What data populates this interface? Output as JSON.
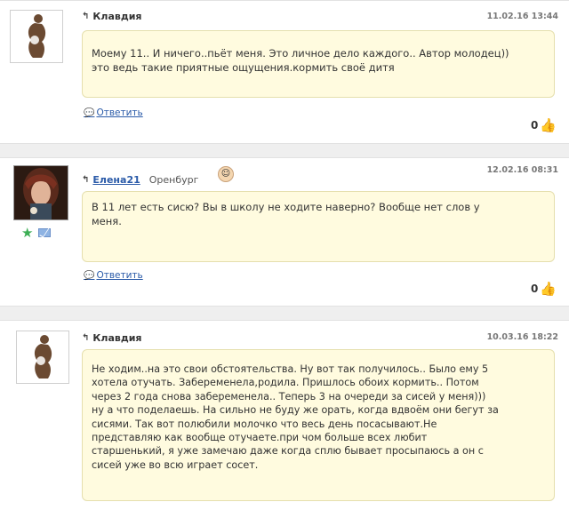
{
  "posts": [
    {
      "author": "Клавдия",
      "date": "11.02.16 13:44",
      "text": "Моему 11.. И ничего..пьёт меня. Это личное дело каждого.. Автор молодец))\nэто ведь такие приятные ощущения.кормить своё дитя",
      "reply_label": "Ответить",
      "likes": "0",
      "avatar_icon": "mother-silhouette-icon"
    },
    {
      "author": "Елена21",
      "city": "Оренбург",
      "date": "12.02.16 08:31",
      "text": "В 11 лет есть сисю? Вы в школу не ходите наверно? Вообще нет слов у\nменя.",
      "reply_label": "Ответить",
      "likes": "0",
      "avatar_icon": "user-photo",
      "badge_icons": [
        "star-icon",
        "mail-icon",
        "baby-icon"
      ]
    },
    {
      "author": "Клавдия",
      "date": "10.03.16 18:22",
      "text": "Не ходим..на это свои обстоятельства. Ну вот так получилось.. Было ему 5\nхотела отучать. Забеременела,родила. Пришлось обоих кормить.. Потом\nчерез 2 года снова забеременела.. Теперь 3 на очереди за сисей у меня)))\nну а что поделаешь. На сильно не буду же орать, когда вдвоём они бегут за\nсисями. Так вот полюбили молочко что весь день посасывают.Не\nпредставляю как вообще отучаете.при чом больше всех любит\nстаршенький, я уже замечаю даже когда сплю бывает просыпаюсь а он с\nсисей уже во всю играет сосет.",
      "avatar_icon": "mother-silhouette-icon"
    }
  ],
  "colors": {
    "bubble_bg": "#fffbdf",
    "bubble_border": "#e5dfae",
    "link": "#2a5aa8"
  }
}
